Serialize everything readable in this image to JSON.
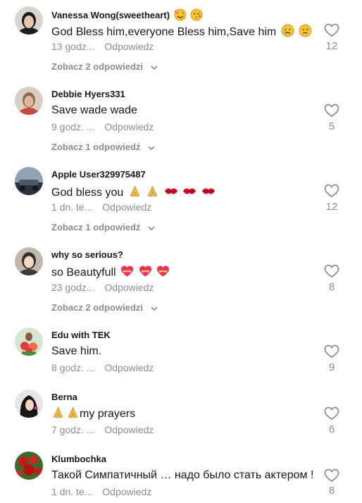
{
  "comments": [
    {
      "username": "Vanessa Wong(sweetheart)",
      "username_emoji": [
        "smiling-face-with-hearts-emoji",
        "face-blowing-kiss-emoji"
      ],
      "text": "God Bless him,everyone Bless him,Save him",
      "text_emoji": [
        "sad-face-emoji",
        "frowning-face-emoji"
      ],
      "time": "13 godz...",
      "reply_label": "Odpowiedz",
      "likes": "12",
      "view_replies": "Zobacz 2 odpowiedzi"
    },
    {
      "username": "Debbie Hyers331",
      "text": "Save wade wade",
      "time": "9 godz. ...",
      "reply_label": "Odpowiedz",
      "likes": "5",
      "view_replies": "Zobacz 1 odpowiedź"
    },
    {
      "username": "Apple User329975487",
      "text": "God bless you",
      "text_emoji": [
        "folded-hands-emoji",
        "folded-hands-emoji",
        "kiss-mark-emoji",
        "kiss-mark-emoji",
        "kiss-mark-emoji"
      ],
      "time": "1 dn. te...",
      "reply_label": "Odpowiedz",
      "likes": "12",
      "view_replies": "Zobacz 1 odpowiedź"
    },
    {
      "username": "why so serious?",
      "text": "so Beautyfull",
      "text_emoji": [
        "heart-with-ribbon-emoji",
        "heart-with-ribbon-emoji",
        "heart-with-ribbon-emoji"
      ],
      "time": "23 godz...",
      "reply_label": "Odpowiedz",
      "likes": "8",
      "view_replies": "Zobacz 2 odpowiedzi"
    },
    {
      "username": "Edu with TEK",
      "text": "Save him.",
      "time": "8 godz. ...",
      "reply_label": "Odpowiedz",
      "likes": "9"
    },
    {
      "username": "Berna",
      "text_emoji_prefix": [
        "folded-hands-emoji",
        "folded-hands-emoji"
      ],
      "text": "my prayers",
      "time": "7 godz. ...",
      "reply_label": "Odpowiedz",
      "likes": "6"
    },
    {
      "username": "Klumbochka",
      "text": "Такой Симпатичный … надо было стать актером !",
      "time": "1 dn. te...",
      "reply_label": "Odpowiedz",
      "likes": "8"
    }
  ],
  "colors": {
    "text": "#161823",
    "muted": "rgba(22,24,35,0.5)",
    "heart_outline": "#8a8b91",
    "kiss_red": "#d0102a",
    "heart_pink": "#e8325f",
    "folded_hands": "#f5b73b",
    "face_yellow": "#f7c331"
  }
}
